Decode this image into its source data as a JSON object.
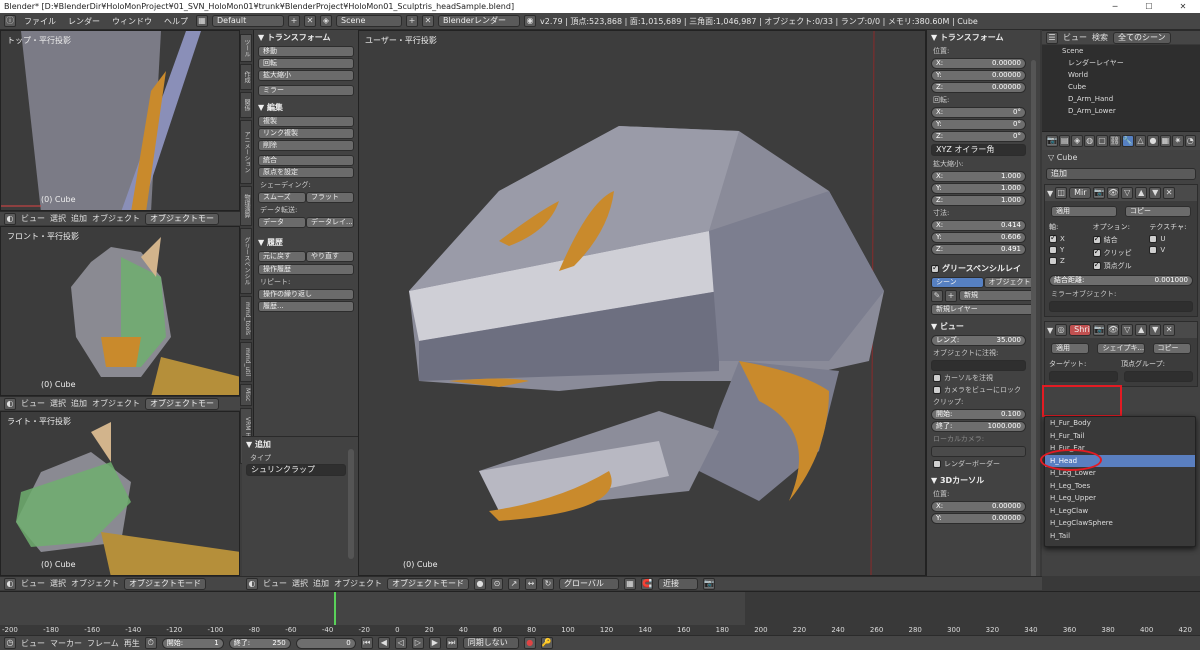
{
  "titlebar": {
    "text": "Blender* [D:¥BlenderDir¥HoloMonProject¥01_SVN_HoloMon01¥trunk¥BlenderProject¥HoloMon01_Sculptris_headSample.blend]",
    "min": "─",
    "max": "☐",
    "close": "✕"
  },
  "menubar": {
    "items": [
      "ファイル",
      "レンダー",
      "ウィンドウ",
      "ヘルプ"
    ],
    "layout": "Default",
    "scene": "Scene",
    "engine": "Blenderレンダー",
    "stats": "v2.79 | 頂点:523,868 | 面:1,015,689 | 三角面:1,046,987 | オブジェクト:0/33 | ランプ:0/0 | メモリ:380.60M | Cube"
  },
  "vp_left": {
    "top": {
      "label": "トップ・平行投影",
      "obj": "(0) Cube"
    },
    "front": {
      "label": "フロント・平行投影",
      "obj": "(0) Cube"
    },
    "right": {
      "label": "ライト・平行投影",
      "obj": "(0) Cube"
    },
    "header_menus": [
      "ビュー",
      "選択",
      "追加",
      "オブジェクト"
    ],
    "mode": "オブジェクトモー"
  },
  "tool_tabs": [
    "ツール",
    "作成",
    "関係",
    "アニメーション",
    "物理演算",
    "グリースペンシル",
    "mmd_tools",
    "mmd_util",
    "Misc",
    "VRM HELPER"
  ],
  "toolshelf": {
    "transform_title": "▼ トランスフォーム",
    "transform_btns": [
      "移動",
      "回転",
      "拡大縮小",
      "ミラー"
    ],
    "edit_title": "▼ 編集",
    "edit_btns": [
      "複製",
      "リンク複製",
      "削除",
      "統合",
      "原点を設定"
    ],
    "shading_label": "シェーディング:",
    "smooth": "スムーズ",
    "flat": "フラット",
    "data_label": "データ転送:",
    "data": "データ",
    "data_layer": "データレイ...",
    "history_title": "▼ 履歴",
    "undo": "元に戻す",
    "redo": "やり直す",
    "op_history": "操作履歴",
    "repeat_label": "リピート:",
    "repeat_last": "操作の繰り返し",
    "history": "履歴...",
    "add_title": "▼ 追加",
    "type_label": "タイプ",
    "type_value": "シュリンクラップ"
  },
  "main_vp": {
    "label": "ユーザー・平行投影",
    "obj": "(0) Cube"
  },
  "props_panel": {
    "transform_title": "▼ トランスフォーム",
    "location": "位置:",
    "loc": [
      [
        "X:",
        "0.00000"
      ],
      [
        "Y:",
        "0.00000"
      ],
      [
        "Z:",
        "0.00000"
      ]
    ],
    "rotation": "回転:",
    "rot": [
      [
        "X:",
        "0°"
      ],
      [
        "Y:",
        "0°"
      ],
      [
        "Z:",
        "0°"
      ]
    ],
    "rotmode": "XYZ オイラー角",
    "scale": "拡大縮小:",
    "scl": [
      [
        "X:",
        "1.000"
      ],
      [
        "Y:",
        "1.000"
      ],
      [
        "Z:",
        "1.000"
      ]
    ],
    "dims": "寸法:",
    "dim": [
      [
        "X:",
        "0.414"
      ],
      [
        "Y:",
        "0.606"
      ],
      [
        "Z:",
        "0.491"
      ]
    ],
    "grease_title": "グリースペンシルレイ",
    "scene_btn": "シーン",
    "object_btn": "オブジェクト",
    "new_btn": "新規",
    "new_layer": "新規レイヤー",
    "view_title": "▼ ビュー",
    "lens": "レンズ:",
    "lens_val": "35.000",
    "lock_to": "オブジェクトに注視:",
    "lock_cursor": "カーソルを注視",
    "lock_camera": "カメラをビューにロック",
    "clip": "クリップ:",
    "clip_start": "開始:",
    "clip_start_val": "0.100",
    "clip_end": "終了:",
    "clip_end_val": "1000.000",
    "local_cam": "ローカルカメラ:",
    "render_border": "レンダーボーダー",
    "cursor_title": "▼ 3Dカーソル",
    "cursor_loc": "位置:",
    "cur": [
      [
        "X:",
        "0.00000"
      ],
      [
        "Y:",
        "0.00000"
      ]
    ]
  },
  "outliner": {
    "menus": [
      "ビュー",
      "検索"
    ],
    "scenes": "全てのシーン",
    "items": [
      "Scene",
      "レンダーレイヤー",
      "World",
      "Cube",
      "D_Arm_Hand",
      "D_Arm_Lower"
    ]
  },
  "modifiers": {
    "object": "Cube",
    "add": "追加",
    "mirror": {
      "name": "Mir",
      "apply": "適用",
      "copy": "コピー",
      "axis": "軸:",
      "options": "オプション:",
      "texture": "テクスチャ:",
      "x": "X",
      "y": "Y",
      "z": "Z",
      "merge": "結合",
      "clipping": "クリッピ",
      "vgroup": "頂点グル",
      "u": "U",
      "v": "V",
      "merge_dist": "結合距離:",
      "merge_val": "0.001000",
      "mirror_obj": "ミラーオブジェクト:"
    },
    "shrink": {
      "name": "Shri",
      "apply": "適用",
      "shape": "シェイプキ...",
      "copy": "コピー",
      "target": "ターゲット:",
      "vgroup": "頂点グループ:"
    }
  },
  "dropdown": {
    "items": [
      "H_Fur_Body",
      "H_Fur_Tail",
      "H_Fur_Ear",
      "H_Head",
      "H_Leg_Lower",
      "H_Leg_Toes",
      "H_Leg_Upper",
      "H_LegClaw",
      "H_LegClawSphere",
      "H_Tail"
    ],
    "selected_index": 3
  },
  "main_header": {
    "menus": [
      "ビュー",
      "選択",
      "追加",
      "オブジェクト"
    ],
    "mode": "オブジェクトモード",
    "orient": "グローバル",
    "snap": "近接"
  },
  "timeline": {
    "ticks": [
      "-200",
      "-180",
      "-160",
      "-140",
      "-120",
      "-100",
      "-80",
      "-60",
      "-40",
      "-20",
      "0",
      "20",
      "40",
      "60",
      "80",
      "100",
      "120",
      "140",
      "160",
      "180",
      "200",
      "220",
      "240",
      "260",
      "280",
      "300",
      "320",
      "340",
      "360",
      "380",
      "400",
      "420"
    ],
    "current_frame": 0
  },
  "bottombar": {
    "menus": [
      "ビュー",
      "マーカー",
      "フレーム",
      "再生"
    ],
    "start": "開始:",
    "start_val": "1",
    "end": "終了:",
    "end_val": "250",
    "frame": "0",
    "sync": "同期しない"
  }
}
